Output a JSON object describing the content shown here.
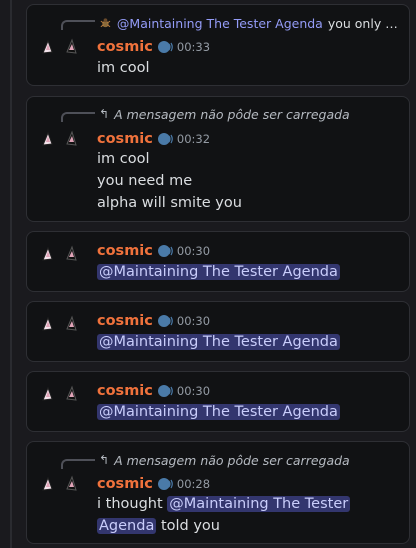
{
  "messages": [
    {
      "reply_mention": "@Maintaining The Tester Agenda",
      "reply_text": "you only g...",
      "author": "cosmic",
      "time": "00:33",
      "lines": [
        "im cool"
      ]
    },
    {
      "reply_missing": "A mensagem não pôde ser carregada",
      "author": "cosmic",
      "time": "00:32",
      "lines": [
        "im cool",
        "you need me",
        "alpha will smite you"
      ]
    },
    {
      "author": "cosmic",
      "time": "00:30",
      "mention": "@Maintaining The Tester Agenda"
    },
    {
      "author": "cosmic",
      "time": "00:30",
      "mention": "@Maintaining The Tester Agenda"
    },
    {
      "author": "cosmic",
      "time": "00:30",
      "mention": "@Maintaining The Tester Agenda"
    },
    {
      "reply_missing": "A mensagem não pôde ser carregada",
      "author": "cosmic",
      "time": "00:28",
      "text_before": "i thought ",
      "mention_part1": "@Maintaining The Tester",
      "mention_part2": "Agenda",
      "text_after": "told you"
    }
  ],
  "colors": {
    "username": "#f0723c",
    "mention_bg": "#33366e",
    "mention_text": "#c9cdfb",
    "card_bg": "#111214"
  },
  "icons": {
    "avatar": "cat-ears-avatar-icon",
    "badge": "speaking-head-icon",
    "reply": "reply-arrow-icon",
    "reply_author_avatar": "spider-icon"
  }
}
